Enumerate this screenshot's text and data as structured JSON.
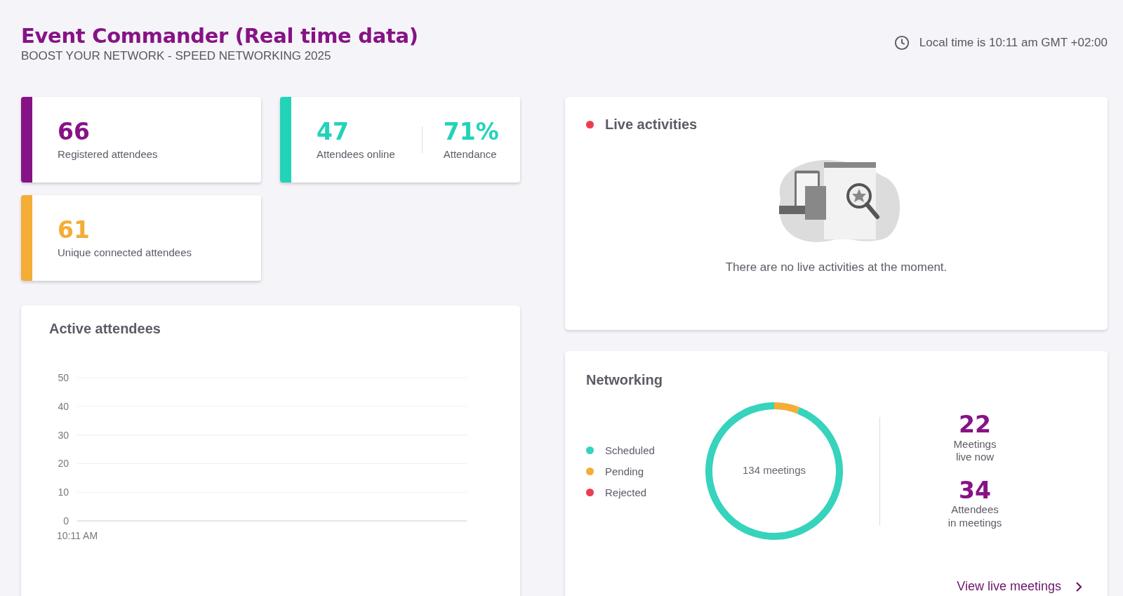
{
  "header": {
    "title": "Event Commander (Real time data)",
    "subtitle": "BOOST YOUR NETWORK - SPEED NETWORKING 2025",
    "local_time": "Local time is 10:11 am GMT +02:00"
  },
  "stat_cards": [
    {
      "color": "#861385",
      "stats": [
        {
          "value": "66",
          "label": "Registered attendees"
        }
      ]
    },
    {
      "color": "#22d3b8",
      "stats": [
        {
          "value": "47",
          "label": "Attendees online"
        },
        {
          "value": "71%",
          "label": "Attendance"
        }
      ]
    },
    {
      "color": "#f4ad36",
      "stats": [
        {
          "value": "61",
          "label": "Unique connected attendees"
        }
      ]
    }
  ],
  "active_attendees": {
    "title": "Active attendees",
    "chart_data": {
      "type": "line",
      "x": [
        "10:11 AM"
      ],
      "ylim": [
        0,
        50
      ],
      "yticks": [
        0,
        10,
        20,
        30,
        40,
        50
      ],
      "grid": true
    }
  },
  "live_activities": {
    "title": "Live activities",
    "empty_message": "There are no live activities at the moment."
  },
  "networking": {
    "title": "Networking",
    "chart_data": {
      "type": "donut",
      "categories": [
        "Scheduled",
        "Pending",
        "Rejected"
      ],
      "values": [
        94,
        6,
        0
      ],
      "colors": [
        "#36d3bd",
        "#f4ad36",
        "#ee3b4f"
      ]
    },
    "center_label": "134 meetings",
    "stats": [
      {
        "value": "22",
        "label": "Meetings live now"
      },
      {
        "value": "34",
        "label": "Attendees in meetings"
      }
    ],
    "link": "View live meetings"
  }
}
